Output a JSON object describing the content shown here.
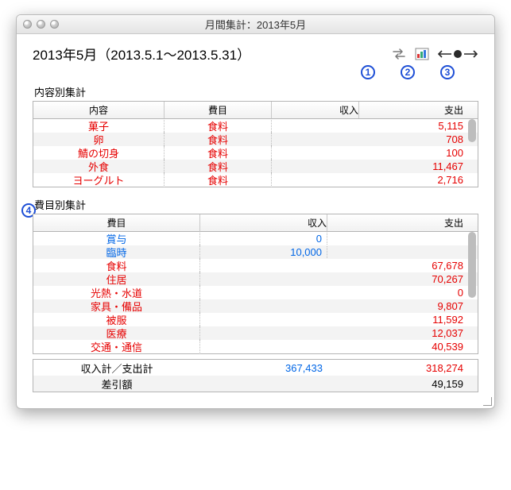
{
  "window": {
    "title": "月間集計：2013年5月"
  },
  "period": "2013年5月（2013.5.1〜2013.5.31）",
  "badges": {
    "b1": "1",
    "b2": "2",
    "b3": "3",
    "b4": "4"
  },
  "section1": {
    "label": "内容別集計",
    "headers": {
      "c1": "内容",
      "c2": "費目",
      "c3": "収入",
      "c4": "支出"
    },
    "rows": [
      {
        "c1": "菓子",
        "c2": "食料",
        "c3": "",
        "c4": "5,115"
      },
      {
        "c1": "卵",
        "c2": "食料",
        "c3": "",
        "c4": "708"
      },
      {
        "c1": "鯖の切身",
        "c2": "食料",
        "c3": "",
        "c4": "100"
      },
      {
        "c1": "外食",
        "c2": "食料",
        "c3": "",
        "c4": "11,467"
      },
      {
        "c1": "ヨーグルト",
        "c2": "食料",
        "c3": "",
        "c4": "2,716"
      }
    ]
  },
  "section2": {
    "label": "費目別集計",
    "headers": {
      "c1": "費目",
      "c2": "収入",
      "c3": "支出"
    },
    "rows": [
      {
        "c1": "賞与",
        "c2": "0",
        "c3": "",
        "color": "blue"
      },
      {
        "c1": "臨時",
        "c2": "10,000",
        "c3": "",
        "color": "blue"
      },
      {
        "c1": "食料",
        "c2": "",
        "c3": "67,678",
        "color": "red"
      },
      {
        "c1": "住居",
        "c2": "",
        "c3": "70,267",
        "color": "red"
      },
      {
        "c1": "光熱・水道",
        "c2": "",
        "c3": "0",
        "color": "red"
      },
      {
        "c1": "家具・備品",
        "c2": "",
        "c3": "9,807",
        "color": "red"
      },
      {
        "c1": "被服",
        "c2": "",
        "c3": "11,592",
        "color": "red"
      },
      {
        "c1": "医療",
        "c2": "",
        "c3": "12,037",
        "color": "red"
      },
      {
        "c1": "交通・通信",
        "c2": "",
        "c3": "40,539",
        "color": "red"
      }
    ]
  },
  "summary": {
    "rows": [
      {
        "c1": "収入計／支出計",
        "c2": "367,433",
        "c3": "318,274",
        "c2color": "blue",
        "c3color": "red"
      },
      {
        "c1": "差引額",
        "c2": "",
        "c3": "49,159"
      }
    ]
  }
}
